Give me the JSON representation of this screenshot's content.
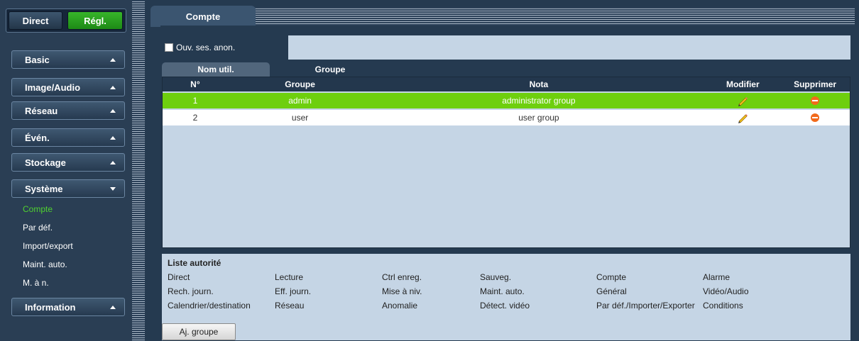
{
  "mode": {
    "direct": "Direct",
    "regl": "Régl."
  },
  "nav": {
    "basic": "Basic",
    "image_audio": "Image/Audio",
    "reseau": "Réseau",
    "even": "Évén.",
    "stockage": "Stockage",
    "systeme": "Système",
    "information": "Information"
  },
  "systeme_items": [
    "Compte",
    "Par déf.",
    "Import/export",
    "Maint. auto.",
    "M. à n."
  ],
  "tab": {
    "compte": "Compte"
  },
  "anon": {
    "label": "Ouv. ses. anon."
  },
  "subtabs": {
    "user": "Nom util.",
    "group": "Groupe"
  },
  "table": {
    "headers": {
      "no": "N°",
      "groupe": "Groupe",
      "nota": "Nota",
      "modifier": "Modifier",
      "supprimer": "Supprimer"
    },
    "rows": [
      {
        "no": "1",
        "groupe": "admin",
        "nota": "administrator group"
      },
      {
        "no": "2",
        "groupe": "user",
        "nota": "user group"
      }
    ]
  },
  "permissions": {
    "title": "Liste autorité",
    "items": [
      "Direct",
      "Lecture",
      "Ctrl enreg.",
      "Sauveg.",
      "Compte",
      "Alarme",
      "Rech. journ.",
      "Eff. journ.",
      "Mise à niv.",
      "Maint. auto.",
      "Général",
      "Vidéo/Audio",
      "Calendrier/destination",
      "Réseau",
      "Anomalie",
      "Détect. vidéo",
      "Par déf./Importer/Exporter",
      "Conditions"
    ]
  },
  "add_group": "Aj. groupe",
  "colors": {
    "selected_row": "#6ecf0e",
    "active_mode": "#37b52a",
    "active_sub": "#4fd12f",
    "delete": "#f26a1b"
  },
  "icons": {
    "edit": "pencil-icon",
    "delete": "minus-circle-icon",
    "expand": "triangle-up-icon",
    "collapse": "triangle-down-icon"
  }
}
